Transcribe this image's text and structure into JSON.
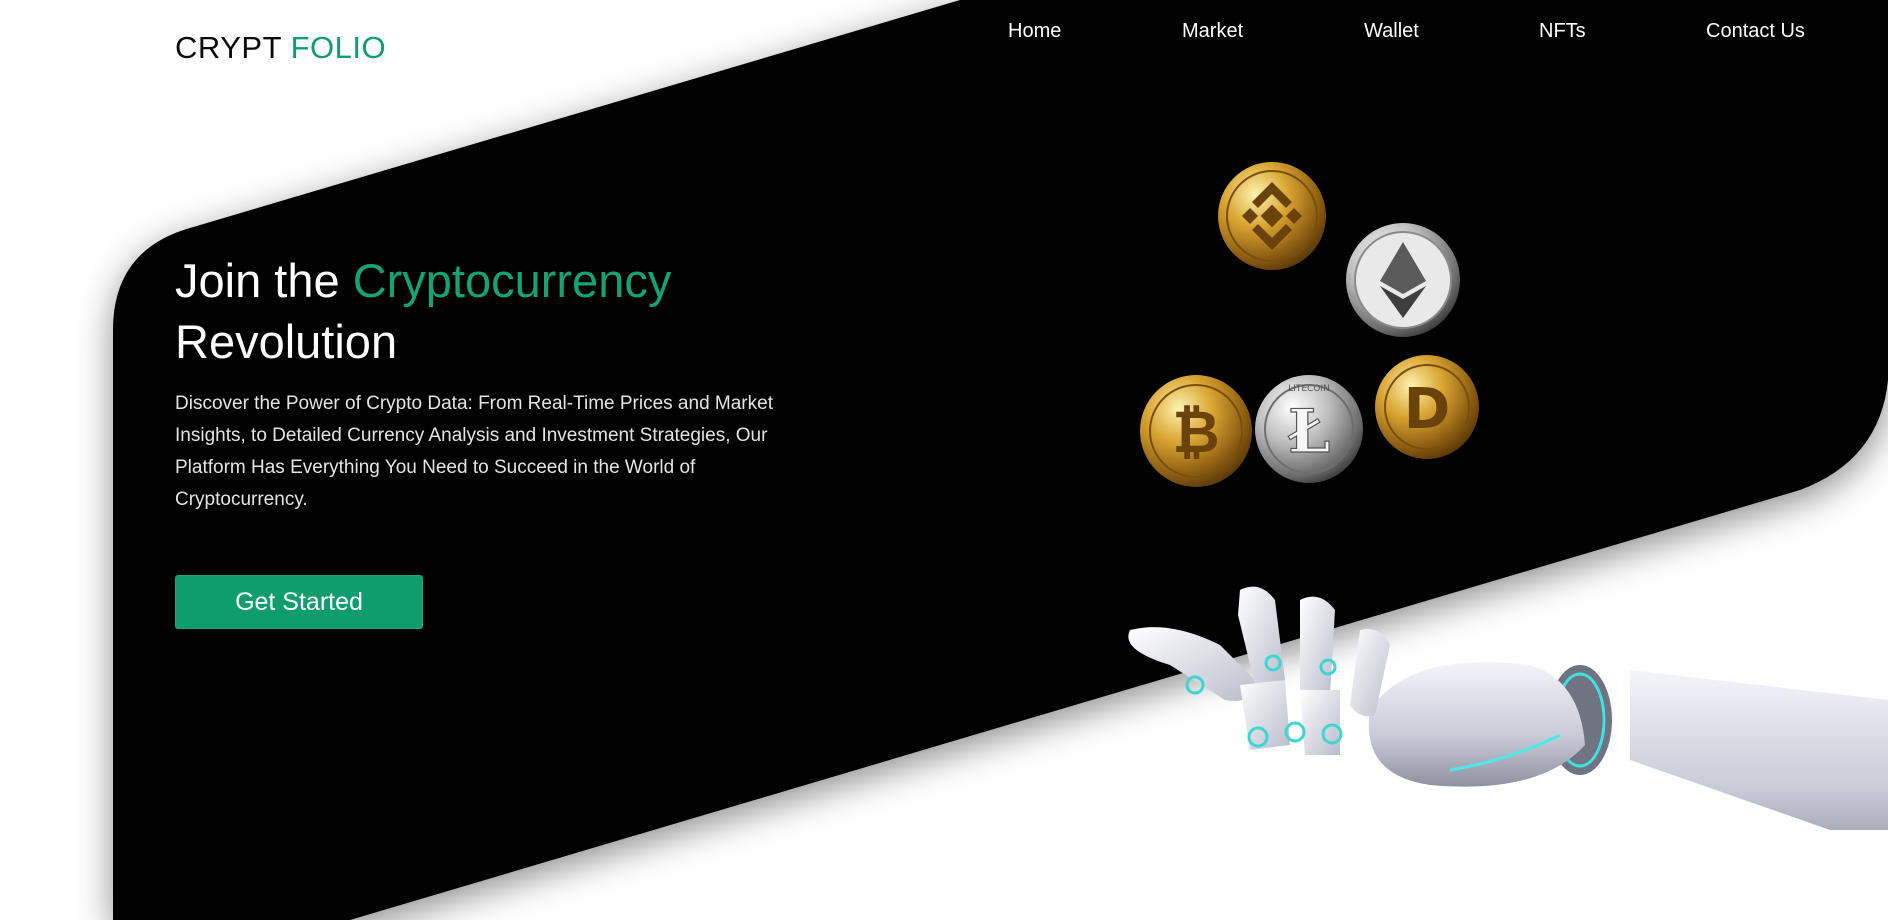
{
  "header": {
    "logo": {
      "part1": "CRYPT",
      "part2": "FOLIO"
    },
    "nav": [
      {
        "label": "Home"
      },
      {
        "label": "Market"
      },
      {
        "label": "Wallet"
      },
      {
        "label": "NFTs"
      },
      {
        "label": "Contact Us"
      }
    ]
  },
  "hero": {
    "title_part1": "Join the ",
    "title_accent": "Cryptocurrency",
    "title_part2": "Revolution",
    "description": "Discover the Power of Crypto Data: From Real-Time Prices and Market Insights, to Detailed Currency Analysis and Investment Strategies, Our Platform Has Everything You Need to Succeed in the World of Cryptocurrency.",
    "cta_label": "Get Started"
  },
  "visual": {
    "coins": [
      "binance-coin",
      "ethereum-coin",
      "bitcoin-coin",
      "litecoin-coin",
      "dogecoin-coin"
    ],
    "litecoin_engraving": "LITECOIN",
    "illustration": "robot-hand"
  },
  "theme": {
    "accent": "#0f9d6e",
    "background": "#ffffff",
    "panel": "#000000",
    "text_light": "#ffffff"
  }
}
